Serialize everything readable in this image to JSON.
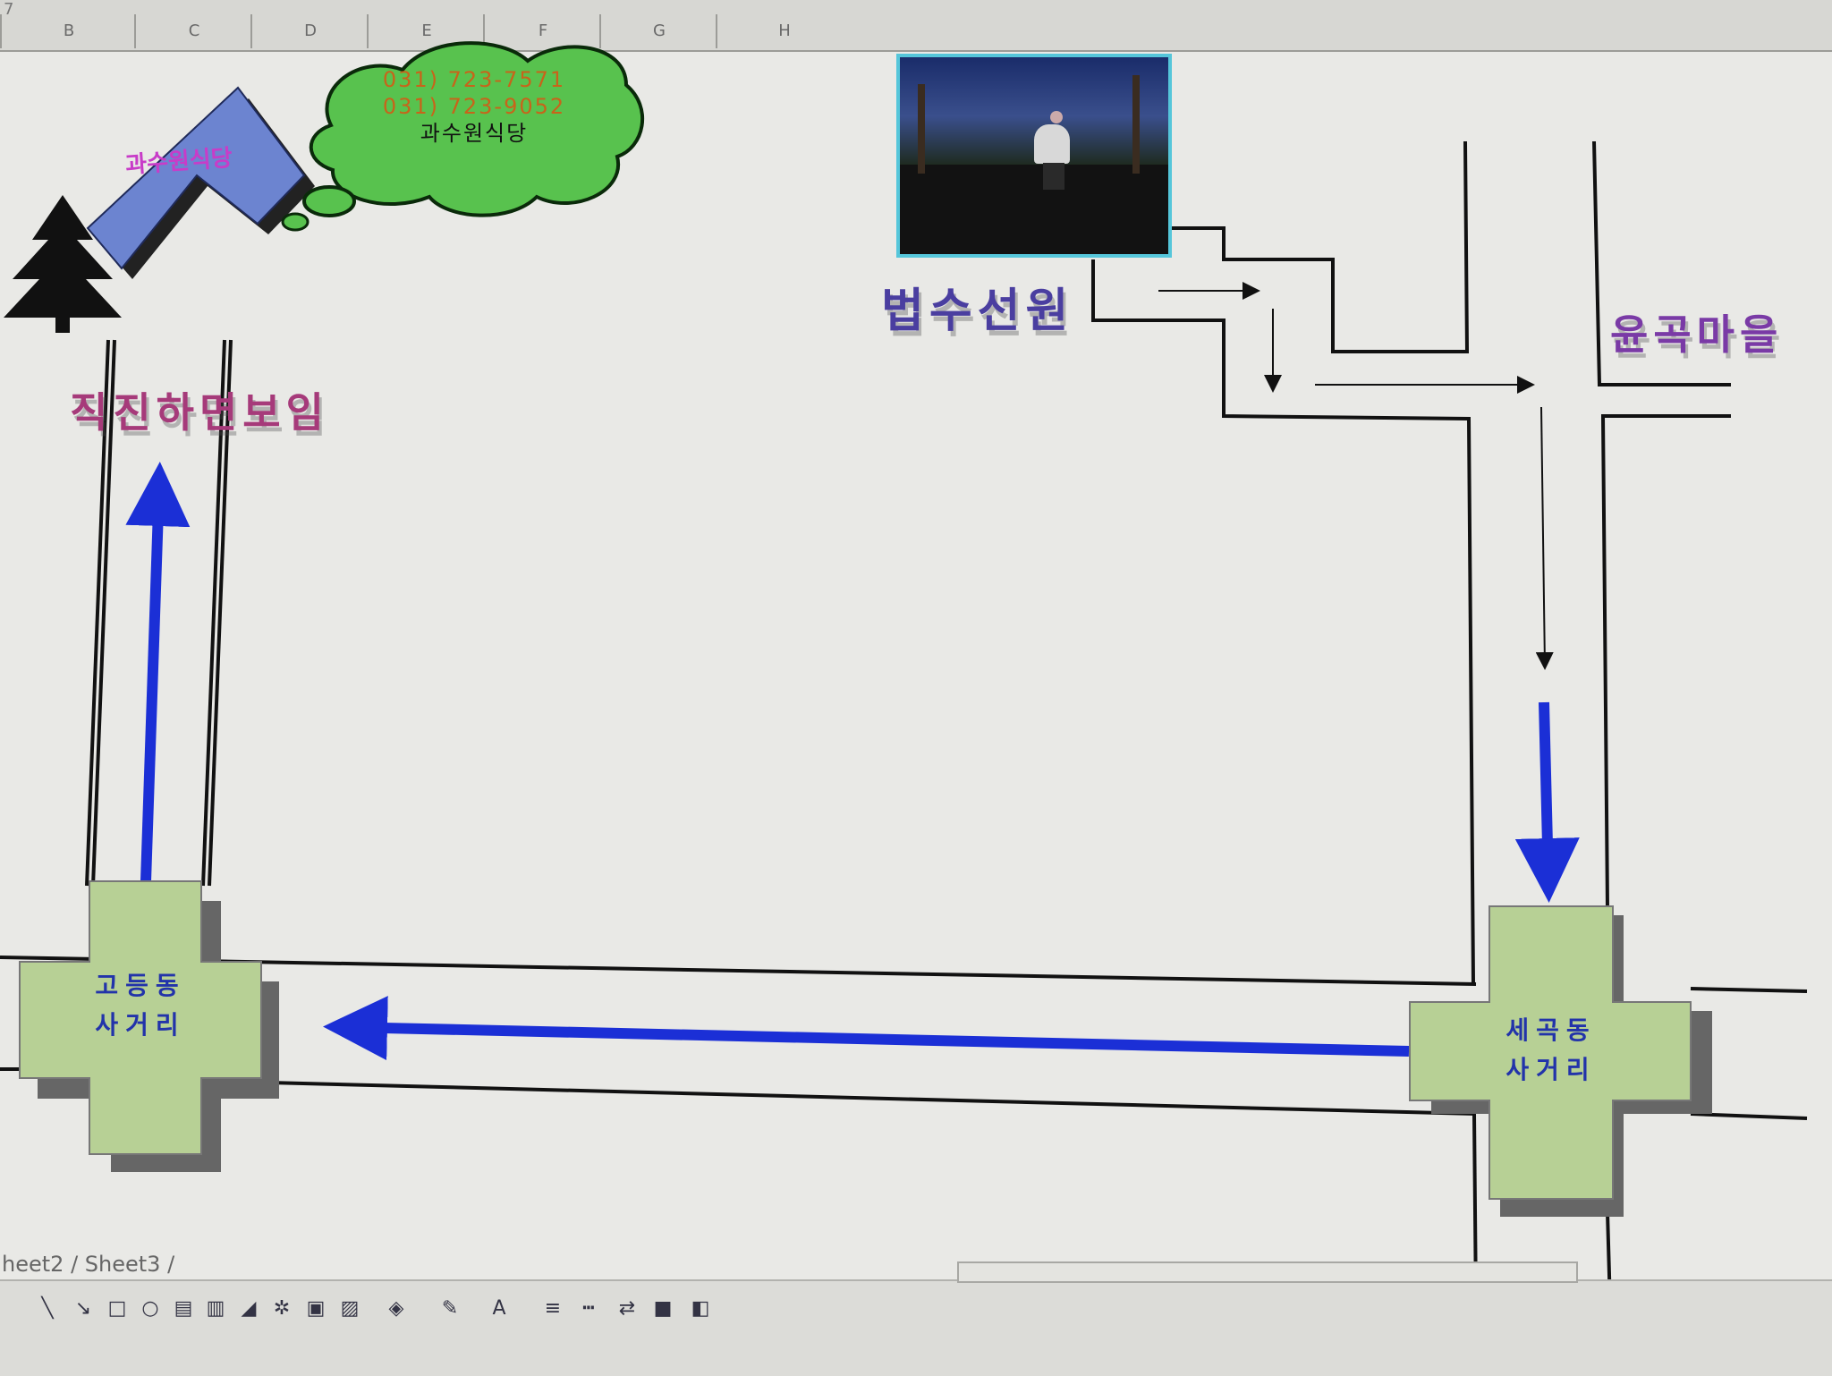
{
  "spreadsheet": {
    "column_headers": [
      "B",
      "C",
      "D",
      "E",
      "F",
      "G",
      "H"
    ],
    "sheet_tabs": [
      "heet2",
      "Sheet3"
    ],
    "cell_ref": "7"
  },
  "map": {
    "restaurant_label": "과수원식당",
    "bubble": {
      "phone1": "031) 723-7571",
      "phone2": "031) 723-9052",
      "name": "과수원식당"
    },
    "left_road_label": "직진하면보임",
    "temple_label": "법수선원",
    "village_label": "윤곡마을",
    "intersection_left": {
      "line1": "고등동",
      "line2": "사거리"
    },
    "intersection_right": {
      "line1": "세곡동",
      "line2": "사거리"
    }
  },
  "icons": {
    "tree": "tree-icon",
    "photo": "photo-thumbnail"
  },
  "colors": {
    "road_arrow": "#1b2fd6",
    "intersection_fill": "#b7d095",
    "bubble_fill": "#58c24e",
    "building_fill": "#6c84d0",
    "background": "#e9e9e6"
  }
}
